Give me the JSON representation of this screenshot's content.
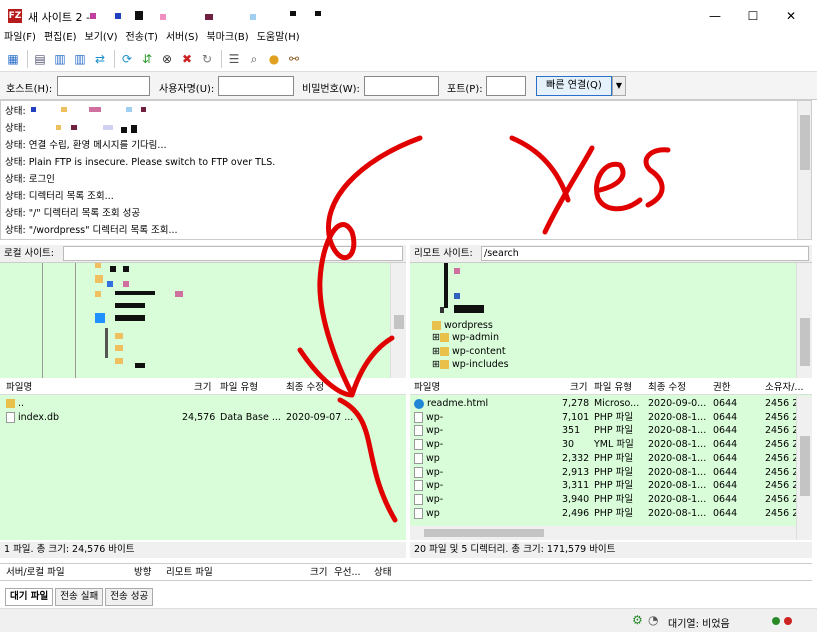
{
  "window": {
    "title": "새 사이트 2 -",
    "app_icon": "FZ",
    "min": "—",
    "max": "☐",
    "close": "✕"
  },
  "menu": [
    "파일(F)",
    "편집(E)",
    "보기(V)",
    "전송(T)",
    "서버(S)",
    "북마크(B)",
    "도움말(H)"
  ],
  "toolbar_icons": [
    "site-manager-icon",
    "toggle-log-icon",
    "toggle-local-tree-icon",
    "toggle-remote-tree-icon",
    "transfer-queue-icon",
    "refresh-icon",
    "process-queue-icon",
    "cancel-icon",
    "disconnect-icon",
    "reconnect-icon",
    "filter-icon",
    "compare-icon",
    "sync-browse-icon",
    "find-icon"
  ],
  "quickconnect": {
    "host_label": "호스트(H):",
    "user_label": "사용자명(U):",
    "pass_label": "비밀번호(W):",
    "port_label": "포트(P):",
    "host_value": "",
    "user_value": "",
    "pass_value": "",
    "port_value": "",
    "button": "빠른 연결(Q)",
    "dropdown": "▼"
  },
  "log": [
    "상태:",
    "상태:",
    "상태: 연결 수립, 환영 메시지를 기다림...",
    "상태: Plain FTP is insecure. Please switch to FTP over TLS.",
    "상태: 로그인",
    "상태: 디렉터리 목록 조회...",
    "상태: \"/\" 디렉터리 목록 조회 성공",
    "상태: \"/wordpress\" 디렉터리 목록 조회..."
  ],
  "local": {
    "site_label": "로컬 사이트:",
    "columns": [
      "파일명",
      "크기",
      "파일 유형",
      "최종 수정"
    ],
    "rows": [
      {
        "name": "..",
        "size": "",
        "type": "",
        "modified": ""
      },
      {
        "name": "index.db",
        "size": "24,576",
        "type": "Data Base ...",
        "modified": "2020-09-07 ..."
      }
    ],
    "status": "1 파일. 총 크기: 24,576 바이트"
  },
  "remote": {
    "site_label": "리모트 사이트:",
    "path": "/search",
    "tree": [
      "wordpress",
      "wp-admin",
      "wp-content",
      "wp-includes"
    ],
    "columns": [
      "파일명",
      "크기",
      "파일 유형",
      "최종 수정",
      "권한",
      "소유자/..."
    ],
    "rows": [
      {
        "name": "readme.html",
        "size": "7,278",
        "type": "Microso...",
        "modified": "2020-09-0...",
        "perm": "0644",
        "owner": "2456 2..."
      },
      {
        "name": "wp-",
        "size": "7,101",
        "type": "PHP 파일",
        "modified": "2020-08-1...",
        "perm": "0644",
        "owner": "2456 2..."
      },
      {
        "name": "wp-",
        "size": "351",
        "type": "PHP 파일",
        "modified": "2020-08-1...",
        "perm": "0644",
        "owner": "2456 2..."
      },
      {
        "name": "wp-",
        "size": "30",
        "type": "YML 파일",
        "modified": "2020-08-1...",
        "perm": "0644",
        "owner": "2456 2..."
      },
      {
        "name": "wp",
        "size": "2,332",
        "type": "PHP 파일",
        "modified": "2020-08-1...",
        "perm": "0644",
        "owner": "2456 2..."
      },
      {
        "name": "wp-",
        "size": "2,913",
        "type": "PHP 파일",
        "modified": "2020-08-1...",
        "perm": "0644",
        "owner": "2456 2..."
      },
      {
        "name": "wp-",
        "size": "3,311",
        "type": "PHP 파일",
        "modified": "2020-08-1...",
        "perm": "0644",
        "owner": "2456 2..."
      },
      {
        "name": "wp-",
        "size": "3,940",
        "type": "PHP 파일",
        "modified": "2020-08-1...",
        "perm": "0644",
        "owner": "2456 2..."
      },
      {
        "name": "wp",
        "size": "2,496",
        "type": "PHP 파일",
        "modified": "2020-08-1...",
        "perm": "0644",
        "owner": "2456 2..."
      }
    ],
    "status": "20 파일 및 5 디렉터리. 총 크기: 171,579 바이트"
  },
  "queue": {
    "columns": [
      "서버/로컬 파일",
      "방향",
      "리모트 파일",
      "크기",
      "우선...",
      "상태"
    ],
    "tabs": [
      "대기 파일",
      "전송 실패",
      "전송 성공"
    ]
  },
  "statusbar": {
    "queue_text": "대기열: 비었음"
  },
  "annotation": {
    "text": "Yes",
    "color": "#e00000"
  }
}
